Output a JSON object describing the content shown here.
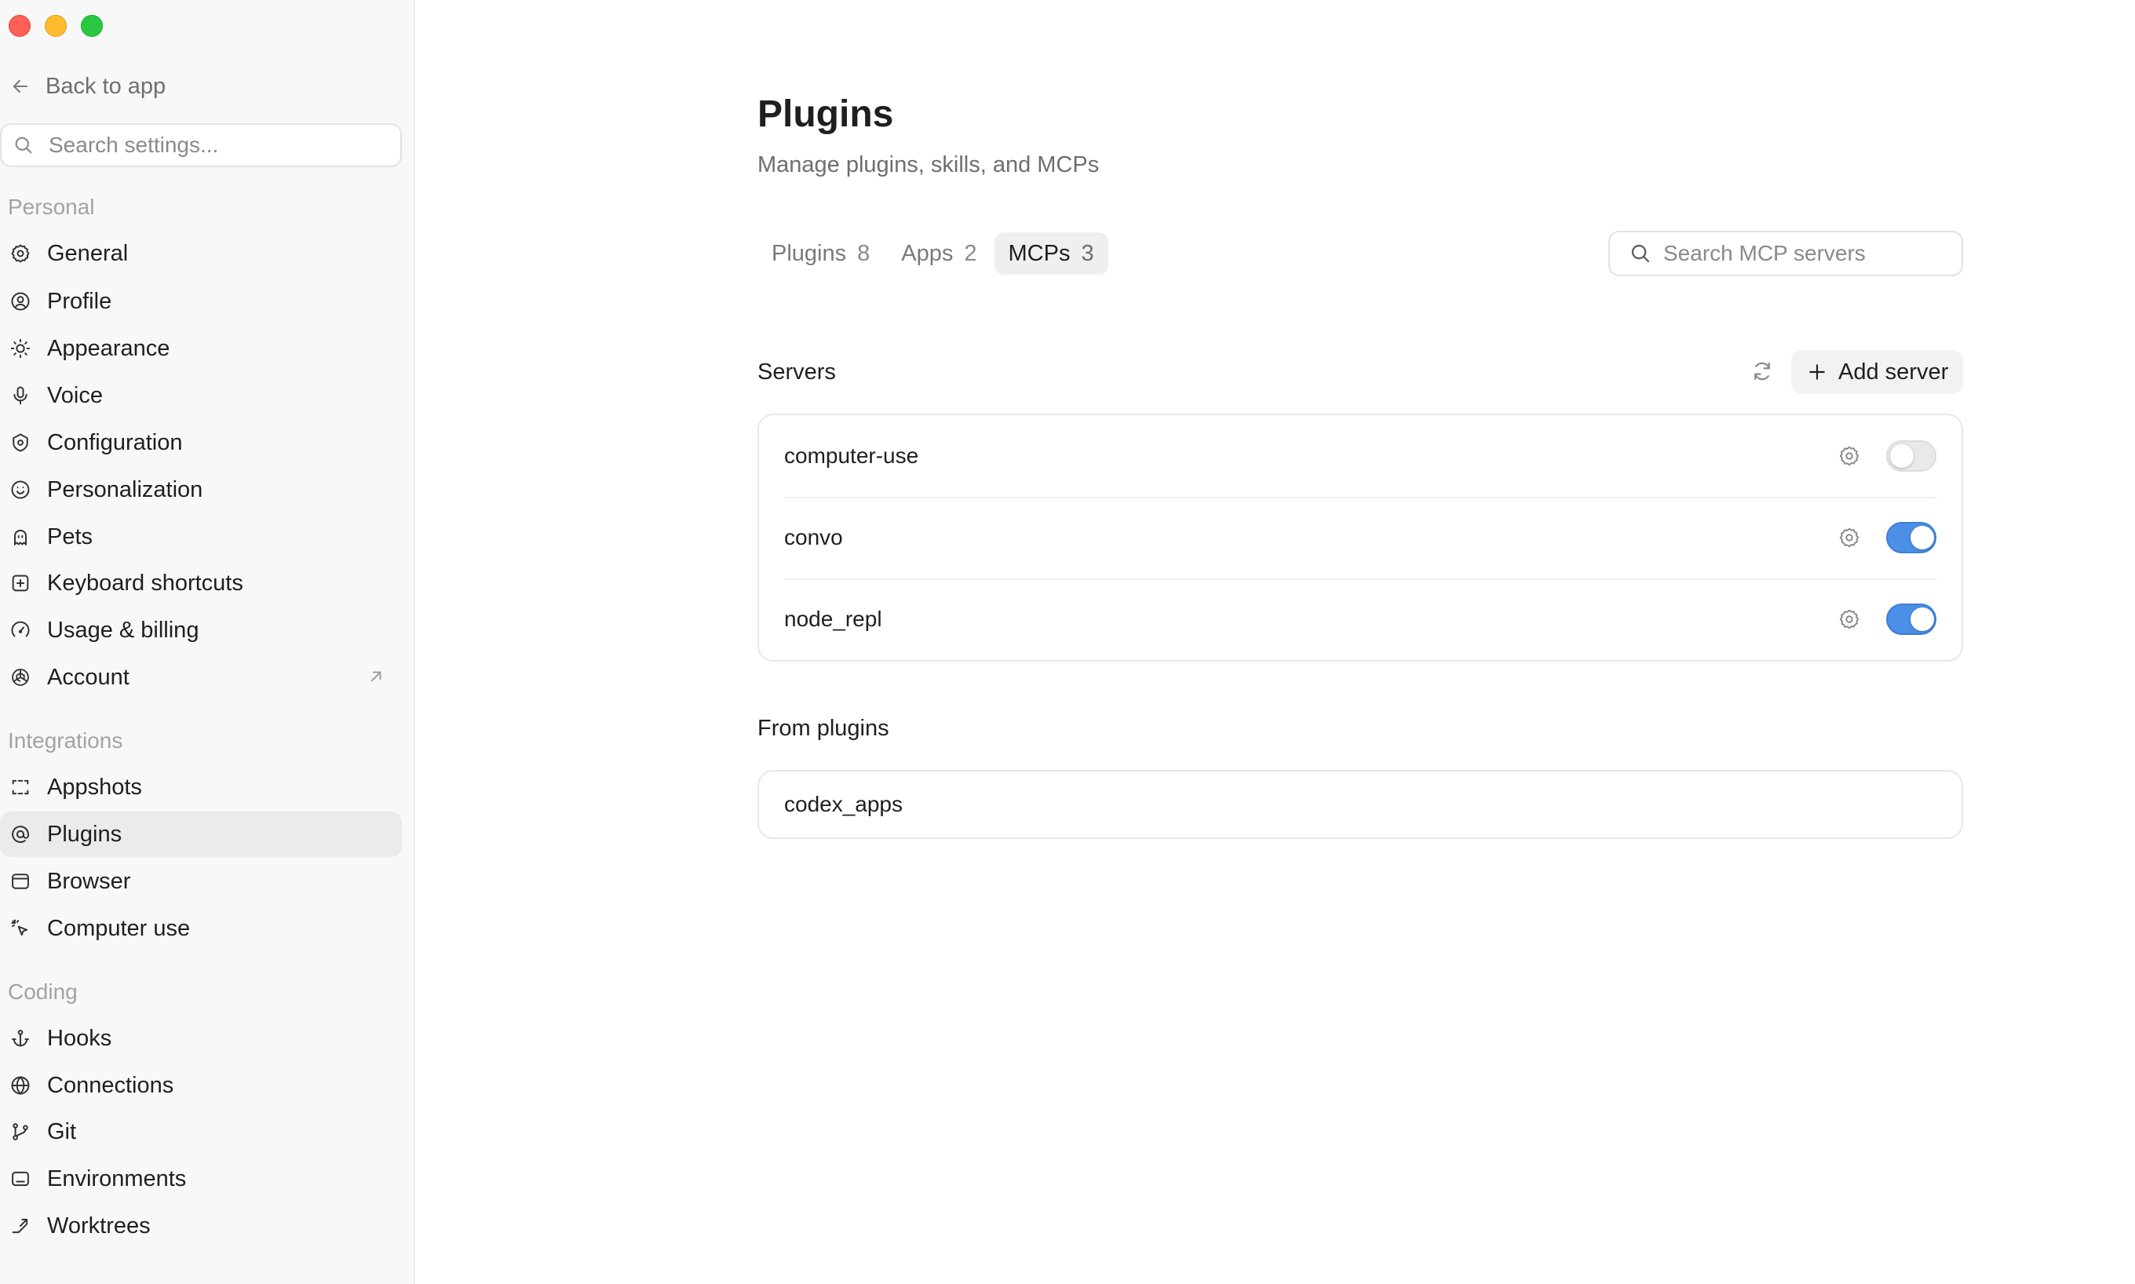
{
  "window": {
    "controls": [
      "close",
      "minimize",
      "zoom"
    ]
  },
  "sidebar": {
    "back_label": "Back to app",
    "search_placeholder": "Search settings...",
    "sections": [
      {
        "label": "Personal",
        "items": [
          {
            "label": "General",
            "icon": "gear-icon"
          },
          {
            "label": "Profile",
            "icon": "user-circle-icon"
          },
          {
            "label": "Appearance",
            "icon": "sun-icon"
          },
          {
            "label": "Voice",
            "icon": "microphone-icon"
          },
          {
            "label": "Configuration",
            "icon": "shield-gear-icon"
          },
          {
            "label": "Personalization",
            "icon": "smile-circle-icon"
          },
          {
            "label": "Pets",
            "icon": "pet-icon"
          },
          {
            "label": "Keyboard shortcuts",
            "icon": "keyboard-command-icon"
          },
          {
            "label": "Usage & billing",
            "icon": "gauge-icon"
          },
          {
            "label": "Account",
            "icon": "openai-logo-icon",
            "external": true
          }
        ]
      },
      {
        "label": "Integrations",
        "items": [
          {
            "label": "Appshots",
            "icon": "screenshot-frame-icon"
          },
          {
            "label": "Plugins",
            "icon": "plugin-at-icon",
            "active": true
          },
          {
            "label": "Browser",
            "icon": "browser-window-icon"
          },
          {
            "label": "Computer use",
            "icon": "cursor-click-icon"
          }
        ]
      },
      {
        "label": "Coding",
        "items": [
          {
            "label": "Hooks",
            "icon": "anchor-icon"
          },
          {
            "label": "Connections",
            "icon": "globe-icon"
          },
          {
            "label": "Git",
            "icon": "git-branch-icon"
          },
          {
            "label": "Environments",
            "icon": "terminal-window-icon"
          },
          {
            "label": "Worktrees",
            "icon": "worktree-icon"
          }
        ]
      }
    ]
  },
  "main": {
    "title": "Plugins",
    "subtitle": "Manage plugins, skills, and MCPs",
    "tabs": [
      {
        "label": "Plugins",
        "count": "8",
        "active": false
      },
      {
        "label": "Apps",
        "count": "2",
        "active": false
      },
      {
        "label": "MCPs",
        "count": "3",
        "active": true
      }
    ],
    "search_placeholder": "Search MCP servers",
    "servers_heading": "Servers",
    "add_server_label": "Add server",
    "servers": [
      {
        "name": "computer-use",
        "enabled": false
      },
      {
        "name": "convo",
        "enabled": true
      },
      {
        "name": "node_repl",
        "enabled": true
      }
    ],
    "from_plugins_heading": "From plugins",
    "plugin_servers": [
      {
        "name": "codex_apps"
      }
    ]
  },
  "colors": {
    "toggle_on": "#4b8fe6",
    "sidebar_bg": "#f8f8f8",
    "active_nav_bg": "#ebebeb"
  }
}
